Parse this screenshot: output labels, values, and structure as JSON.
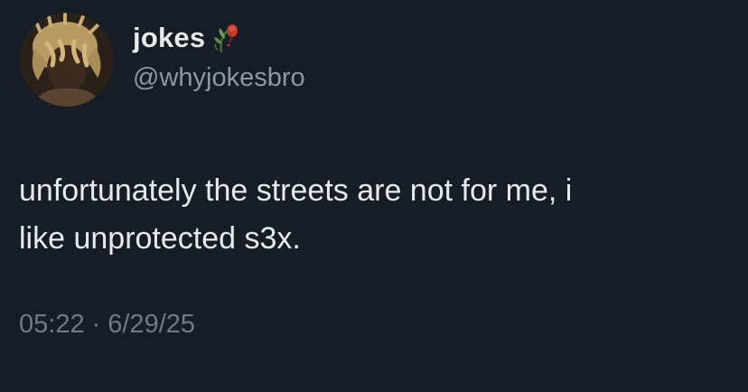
{
  "author": {
    "display_name": "jokes",
    "handle": "@whyjokesbro",
    "name_emoji": "wilted-rose-icon"
  },
  "tweet": {
    "text_line1": "unfortunately the streets are not for me, i",
    "text_line2": "like unprotected s3x.",
    "time": "05:22",
    "separator": "·",
    "date": "6/29/25"
  },
  "colors": {
    "background": "#171d27",
    "text": "#e7e9ea",
    "secondary": "#8b98a5",
    "timestamp": "#6e7a86",
    "rose": "#c0392b"
  }
}
